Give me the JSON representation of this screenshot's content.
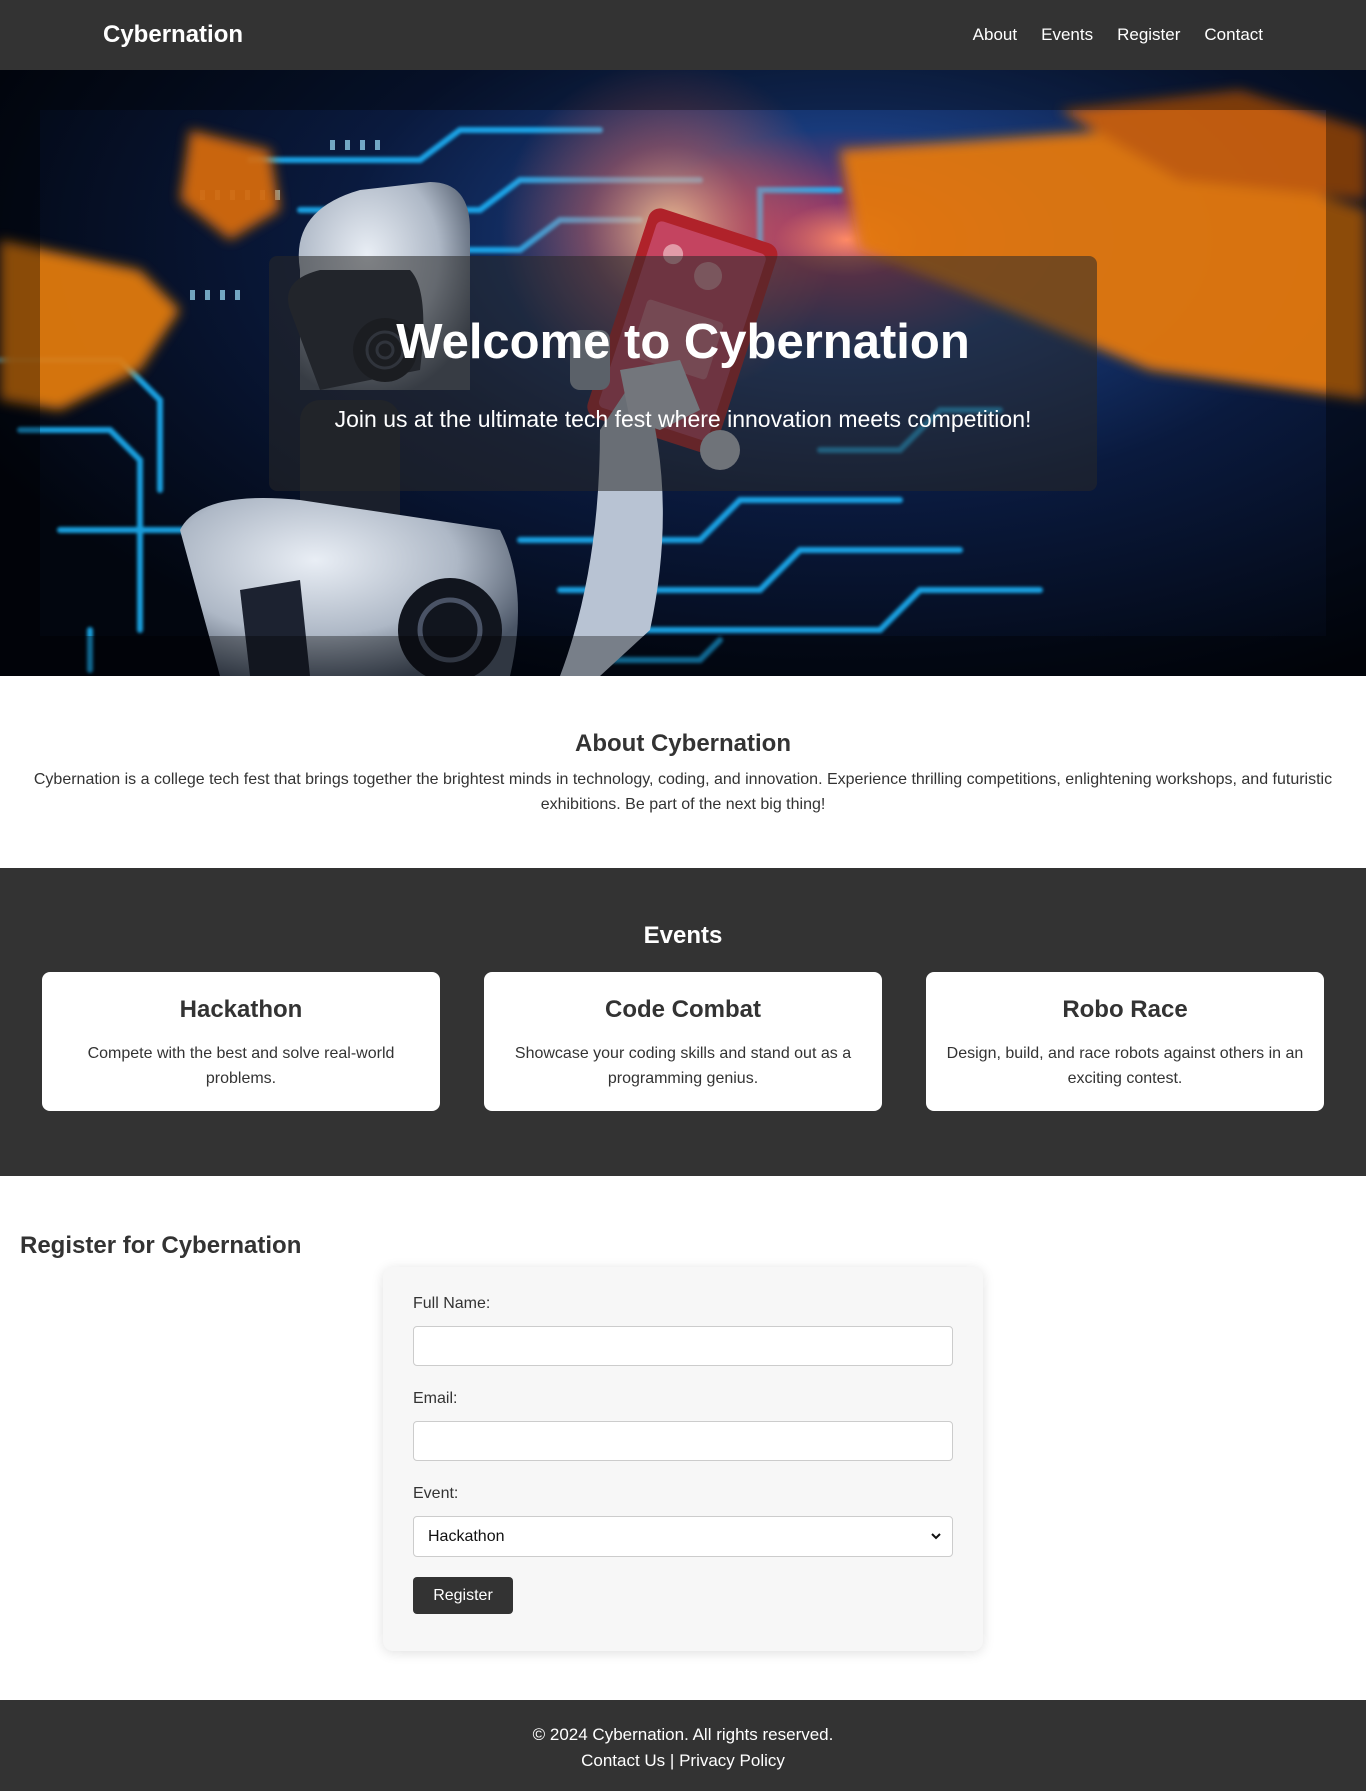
{
  "navbar": {
    "brand": "Cybernation",
    "links": [
      "About",
      "Events",
      "Register",
      "Contact"
    ]
  },
  "hero": {
    "title": "Welcome to Cybernation",
    "subtitle": "Join us at the ultimate tech fest where innovation meets competition!"
  },
  "about": {
    "heading": "About Cybernation",
    "text": "Cybernation is a college tech fest that brings together the brightest minds in technology, coding, and innovation. Experience thrilling competitions, enlightening workshops, and futuristic exhibitions. Be part of the next big thing!"
  },
  "events": {
    "heading": "Events",
    "cards": [
      {
        "title": "Hackathon",
        "description": "Compete with the best and solve real-world problems."
      },
      {
        "title": "Code Combat",
        "description": "Showcase your coding skills and stand out as a programming genius."
      },
      {
        "title": "Robo Race",
        "description": "Design, build, and race robots against others in an exciting contest."
      }
    ]
  },
  "register": {
    "heading": "Register for Cybernation",
    "name_label": "Full Name:",
    "name_value": "",
    "email_label": "Email:",
    "email_value": "",
    "event_label": "Event:",
    "event_selected": "Hackathon",
    "submit_label": "Register"
  },
  "footer": {
    "copyright": "© 2024 Cybernation. All rights reserved.",
    "contact_link": "Contact Us",
    "separator": "|",
    "privacy_link": "Privacy Policy"
  },
  "colors": {
    "dark": "#333333",
    "light": "#ffffff",
    "form_bg": "#f7f7f7",
    "text": "#333333"
  }
}
